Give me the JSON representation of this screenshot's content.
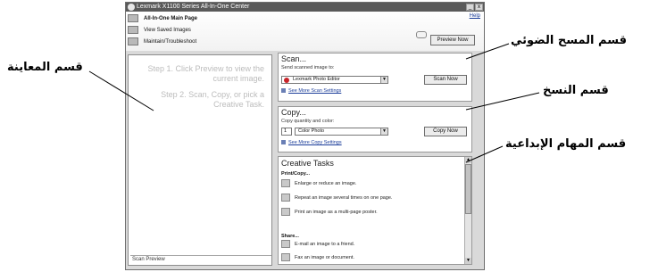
{
  "window": {
    "title": "Lexmark X1100 Series All-In-One Center",
    "minimize_glyph": "_",
    "close_glyph": "x",
    "help_label": "Help"
  },
  "nav": {
    "items": [
      {
        "label": "All-In-One Main Page",
        "icon": "home-icon"
      },
      {
        "label": "View Saved Images",
        "icon": "folder-icon"
      },
      {
        "label": "Maintain/Troubleshoot",
        "icon": "wrench-icon"
      }
    ]
  },
  "preview": {
    "button_label": "Preview Now",
    "step1": "Step 1.  Click Preview to view the current image.",
    "step2": "Step 2.  Scan, Copy, or pick a Creative Task.",
    "status": "Scan Preview"
  },
  "scan": {
    "title": "Scan...",
    "subtitle": "Send scanned image to:",
    "destination": "Lexmark Photo Editor",
    "more_link": "See More Scan Settings",
    "button_label": "Scan Now"
  },
  "copy": {
    "title": "Copy...",
    "subtitle": "Copy quantity and color:",
    "quantity": "1",
    "color_mode": "Color Photo",
    "more_link": "See More Copy Settings",
    "button_label": "Copy Now"
  },
  "creative_tasks": {
    "title": "Creative Tasks",
    "groups": [
      {
        "label": "Print/Copy..."
      },
      {
        "label": "Share..."
      }
    ],
    "tasks": [
      {
        "label": "Enlarge or reduce an image."
      },
      {
        "label": "Repeat an image several times on one page."
      },
      {
        "label": "Print an image as a multi-page poster."
      },
      {
        "label": "E-mail an image to a friend."
      },
      {
        "label": "Fax an image or document."
      }
    ]
  },
  "callouts": {
    "scan": "قسم المسح الضوئي",
    "copy": "قسم النسخ",
    "creative_tasks": "قسم المهام الإبداعية",
    "preview": "قسم المعاينة"
  }
}
